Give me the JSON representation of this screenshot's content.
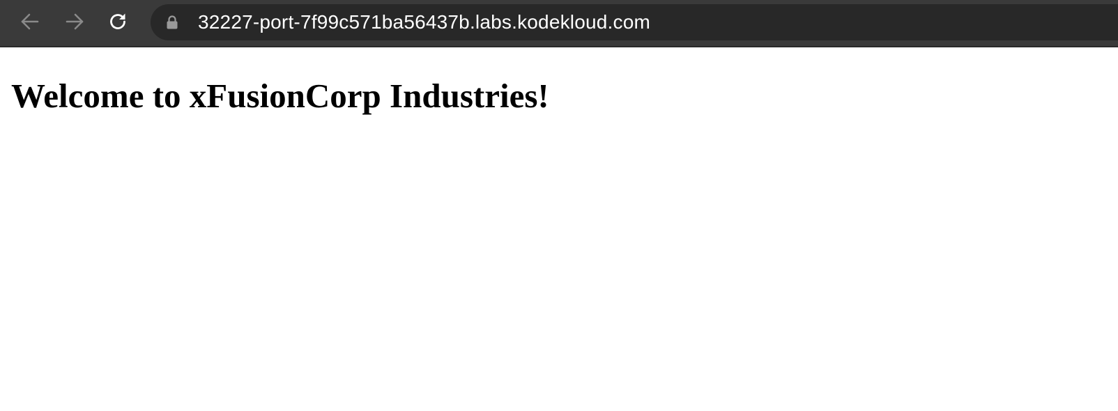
{
  "browser": {
    "toolbar": {
      "icons": {
        "back": "arrow-left-icon",
        "forward": "arrow-right-icon",
        "reload": "reload-icon",
        "lock": "lock-icon"
      },
      "colors": {
        "toolbar_bg": "#3a3a3a",
        "omnibox_bg": "#282828",
        "icon_disabled": "#8a8a8a",
        "icon_enabled": "#ffffff"
      }
    },
    "address_bar": {
      "url": "32227-port-7f99c571ba56437b.labs.kodekloud.com"
    }
  },
  "page": {
    "heading": "Welcome to xFusionCorp Industries!"
  }
}
